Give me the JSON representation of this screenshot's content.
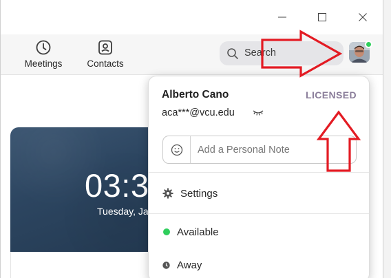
{
  "window": {
    "controls": [
      "minimize",
      "maximize",
      "close"
    ]
  },
  "toolbar": {
    "meetings_label": "Meetings",
    "contacts_label": "Contacts",
    "search_placeholder": "Search",
    "icons": {
      "meetings": "clock-icon",
      "contacts": "contact-card-icon",
      "search": "search-icon"
    }
  },
  "main": {
    "clock_time": "03:3",
    "clock_date": "Tuesday, Ja"
  },
  "profile": {
    "name": "Alberto Cano",
    "license": "LICENSED",
    "email": "aca***@vcu.edu",
    "note_placeholder": "Add a Personal Note",
    "status_color": "#2fce5c",
    "menu": {
      "settings": "Settings",
      "available": "Available",
      "away": "Away"
    }
  },
  "colors": {
    "annotation_red": "#e31b23",
    "clock_card": "#2c4560"
  }
}
